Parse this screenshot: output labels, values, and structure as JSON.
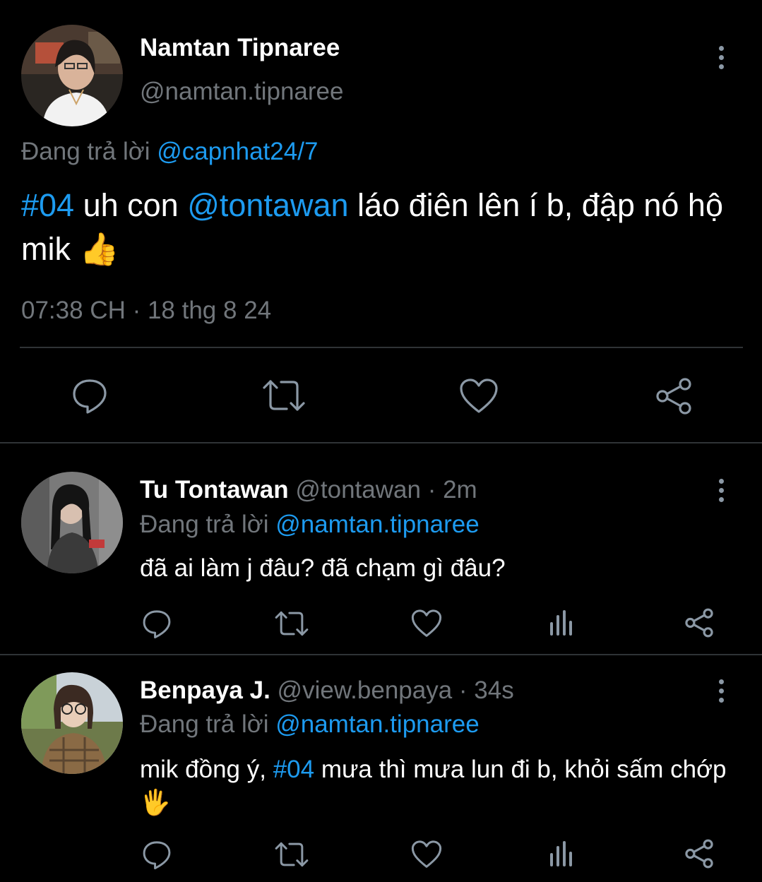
{
  "main_tweet": {
    "display_name": "Namtan Tipnaree",
    "handle": "@namtan.tipnaree",
    "replying_prefix": "Đang trả lời",
    "replying_to": "@capnhat24/7",
    "text_hashtag": "#04",
    "text_part1": " uh con ",
    "text_mention": "@tontawan",
    "text_part2": " láo điên lên í b, đập nó hộ mik ",
    "text_emoji": "👍",
    "timestamp": "07:38 CH · 18 thg 8 24"
  },
  "replies": [
    {
      "display_name": "Tu Tontawan",
      "handle": "@tontawan",
      "time": "· 2m",
      "replying_prefix": "Đang trả lời",
      "replying_to": "@namtan.tipnaree",
      "text": "đã ai làm j đâu? đã chạm gì đâu?"
    },
    {
      "display_name": "Benpaya J.",
      "handle": "@view.benpaya",
      "time": "· 34s",
      "replying_prefix": "Đang trả lời",
      "replying_to": "@namtan.tipnaree",
      "text_part1": "mik đồng ý, ",
      "text_hashtag": "#04",
      "text_part2": " mưa thì mưa lun đi b, khỏi sấm chớp ",
      "text_emoji": "🖐"
    }
  ],
  "icons": {
    "reply": "reply-icon",
    "retweet": "retweet-icon",
    "like": "heart-icon",
    "views": "views-icon",
    "share": "share-icon",
    "more": "more-icon"
  },
  "colors": {
    "background": "#000000",
    "link": "#1d9bf0",
    "muted": "#71767b",
    "icon": "#8b98a5",
    "divider": "#2f3336"
  }
}
